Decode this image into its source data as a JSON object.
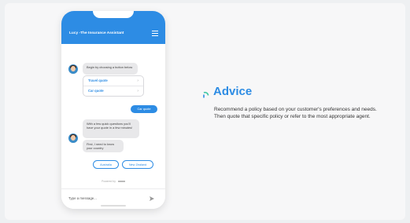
{
  "header": {
    "title": "Lucy -The Insurance Assistant",
    "menu_icon": "hamburger-menu-icon"
  },
  "chat": {
    "bot_message_1": "Begin by choosing a button below",
    "options": [
      {
        "label": "Travel quote",
        "chevron": "›"
      },
      {
        "label": "Car quote",
        "chevron": "›"
      }
    ],
    "user_reply": "Car quote",
    "bot_message_2": "With a few quick questions you'll have your quote in a few minutes!",
    "bot_message_3": "First, I need to know your country",
    "country_options": [
      "Australia",
      "New Zealand"
    ],
    "powered_by": "Powered by"
  },
  "input": {
    "placeholder": "Type a message...",
    "send_icon": "send-arrow-icon"
  },
  "advice": {
    "icon": "advice-arc-icon",
    "title": "Advice",
    "body": "Recommend a policy based on your customer's preferences and needs. Then quote that specific policy or refer to the most appropriate agent.",
    "accent": "#2d8ce4",
    "accent_secondary": "#3ec7a3"
  }
}
